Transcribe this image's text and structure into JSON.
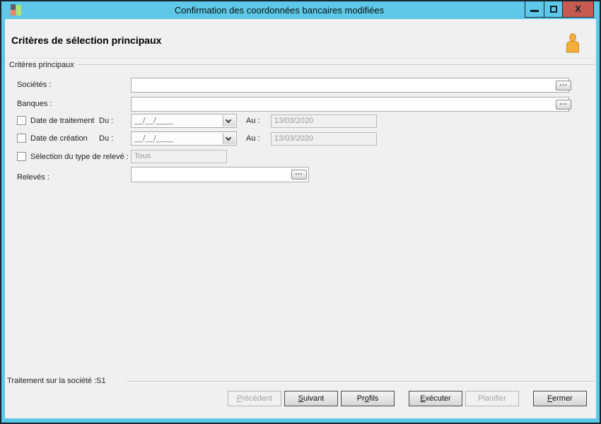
{
  "window": {
    "title": "Confirmation des coordonnées bancaires modifiées",
    "close_glyph": "X"
  },
  "header": {
    "title": "Critères de sélection principaux"
  },
  "main_group": {
    "label": "Critères principaux",
    "browse_label": "...",
    "societes": {
      "label": "Sociétés :",
      "value": ""
    },
    "banques": {
      "label": "Banques :",
      "value": ""
    },
    "date_traitement": {
      "label": "Date de traitement",
      "checked": false,
      "du_label": "Du :",
      "du_value": "__/__/____",
      "au_label": "Au :",
      "au_value": "13/03/2020"
    },
    "date_creation": {
      "label": "Date de création",
      "checked": false,
      "du_label": "Du :",
      "du_value": "__/__/____",
      "au_label": "Au :",
      "au_value": "13/03/2020"
    },
    "type_releve": {
      "label": "Sélection du type de relevé :",
      "checked": false,
      "value": "Tous"
    },
    "releves": {
      "label": "Relevés :",
      "value": ""
    }
  },
  "footer": {
    "status": "Traitement sur la société :S1",
    "buttons": [
      {
        "id": "precedent",
        "pre": "",
        "key": "P",
        "post": "récédent",
        "enabled": false
      },
      {
        "id": "suivant",
        "pre": "",
        "key": "S",
        "post": "uivant",
        "enabled": true
      },
      {
        "id": "profils",
        "pre": "Pr",
        "key": "o",
        "post": "fils",
        "enabled": true
      },
      {
        "id": "executer",
        "pre": "",
        "key": "E",
        "post": "xécuter",
        "enabled": true
      },
      {
        "id": "planifier",
        "pre": "Planifier",
        "key": "",
        "post": "",
        "enabled": false
      },
      {
        "id": "fermer",
        "pre": "",
        "key": "F",
        "post": "ermer",
        "enabled": true
      }
    ]
  },
  "colors": {
    "titlebar_blue": "#5DC8E8",
    "frame_dark": "#162530",
    "close_button_red": "#C75B52",
    "content_bg": "#F0F0F0",
    "user_icon_orange": "#F5AE3D"
  }
}
